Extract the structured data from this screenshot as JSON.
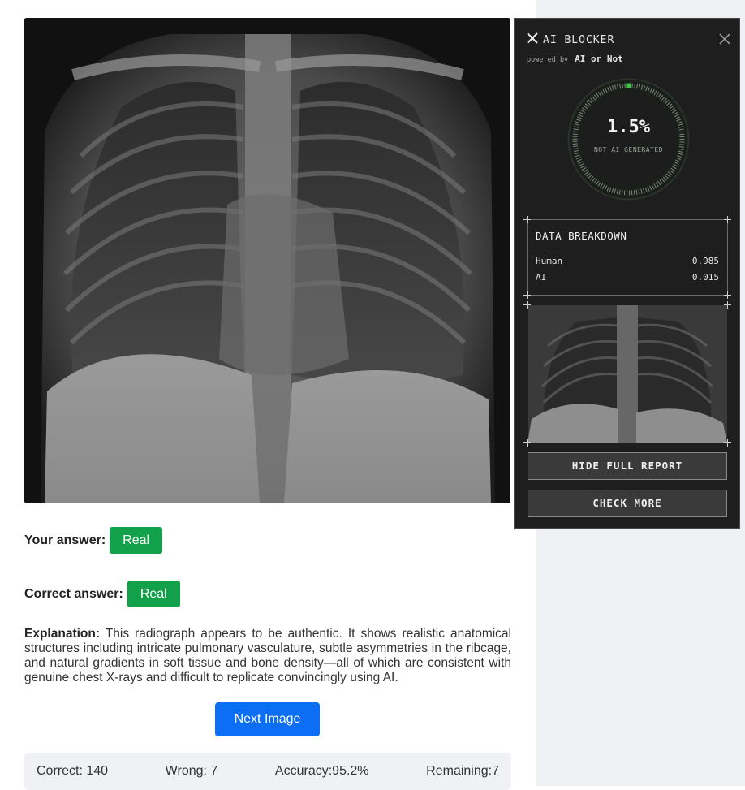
{
  "quiz": {
    "your_answer_label": "Your answer:",
    "your_answer_value": "Real",
    "correct_answer_label": "Correct answer:",
    "correct_answer_value": "Real",
    "explanation_label": "Explanation:",
    "explanation_text": "This radiograph appears to be authentic. It shows realistic anatomical structures including intricate pulmonary vasculature, subtle asymmetries in the ribcage, and natural gradients in soft tissue and bone density—all of which are consistent with genuine chest X-rays and difficult to replicate convincingly using AI.",
    "next_button": "Next Image",
    "stats": {
      "correct": "Correct: 140",
      "wrong": "Wrong: 7",
      "accuracy": "Accuracy:95.2%",
      "remaining": "Remaining:7"
    },
    "answer_color": "#13a04b",
    "button_color": "#0b6ef5"
  },
  "panel": {
    "title": "AI BLOCKER",
    "powered_prefix": "powered by",
    "powered_brand": "AI or Not",
    "score_percent": "1.5%",
    "score_fraction": 0.015,
    "score_label": "NOT AI GENERATED",
    "breakdown_title": "DATA BREAKDOWN",
    "breakdown": [
      {
        "label": "Human",
        "value": "0.985"
      },
      {
        "label": "AI",
        "value": "0.015"
      }
    ],
    "hide_button": "HIDE FULL REPORT",
    "check_button": "CHECK MORE",
    "gauge_color": "#3fc24a"
  }
}
